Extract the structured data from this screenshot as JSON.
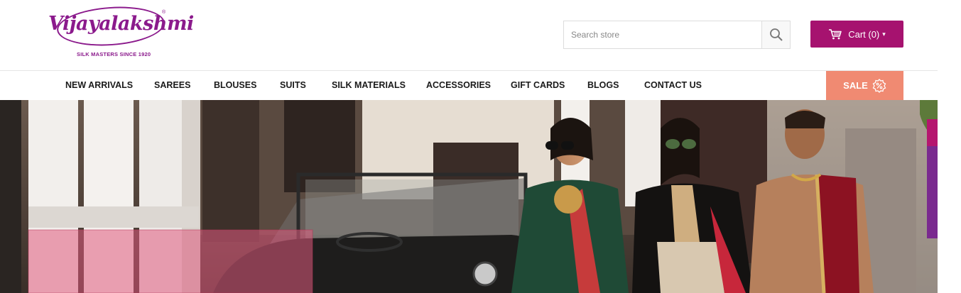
{
  "header": {
    "logo": {
      "wordmark": "Vijayalakshmi",
      "registered": "®",
      "tagline": "SILK MASTERS SINCE 1920"
    },
    "search": {
      "placeholder": "Search store",
      "icon": "search-icon"
    },
    "cart": {
      "label": "Cart (0)",
      "icon": "cart-icon",
      "caret": "▾"
    }
  },
  "nav": {
    "items": [
      {
        "label": "NEW ARRIVALS"
      },
      {
        "label": "SAREES"
      },
      {
        "label": "BLOUSES"
      },
      {
        "label": "SUITS"
      },
      {
        "label": "SILK MATERIALS"
      },
      {
        "label": "ACCESSORIES"
      },
      {
        "label": "GIFT CARDS"
      },
      {
        "label": "BLOGS"
      },
      {
        "label": "CONTACT US"
      }
    ],
    "sale": {
      "label": "SALE",
      "icon": "discount-badge-icon"
    }
  },
  "colors": {
    "brand": "#8b1a8c",
    "cart": "#a6126f",
    "sale": "#f08a72",
    "side_tab_pink": "#b5166f",
    "side_tab_purple": "#7a2a8f"
  }
}
